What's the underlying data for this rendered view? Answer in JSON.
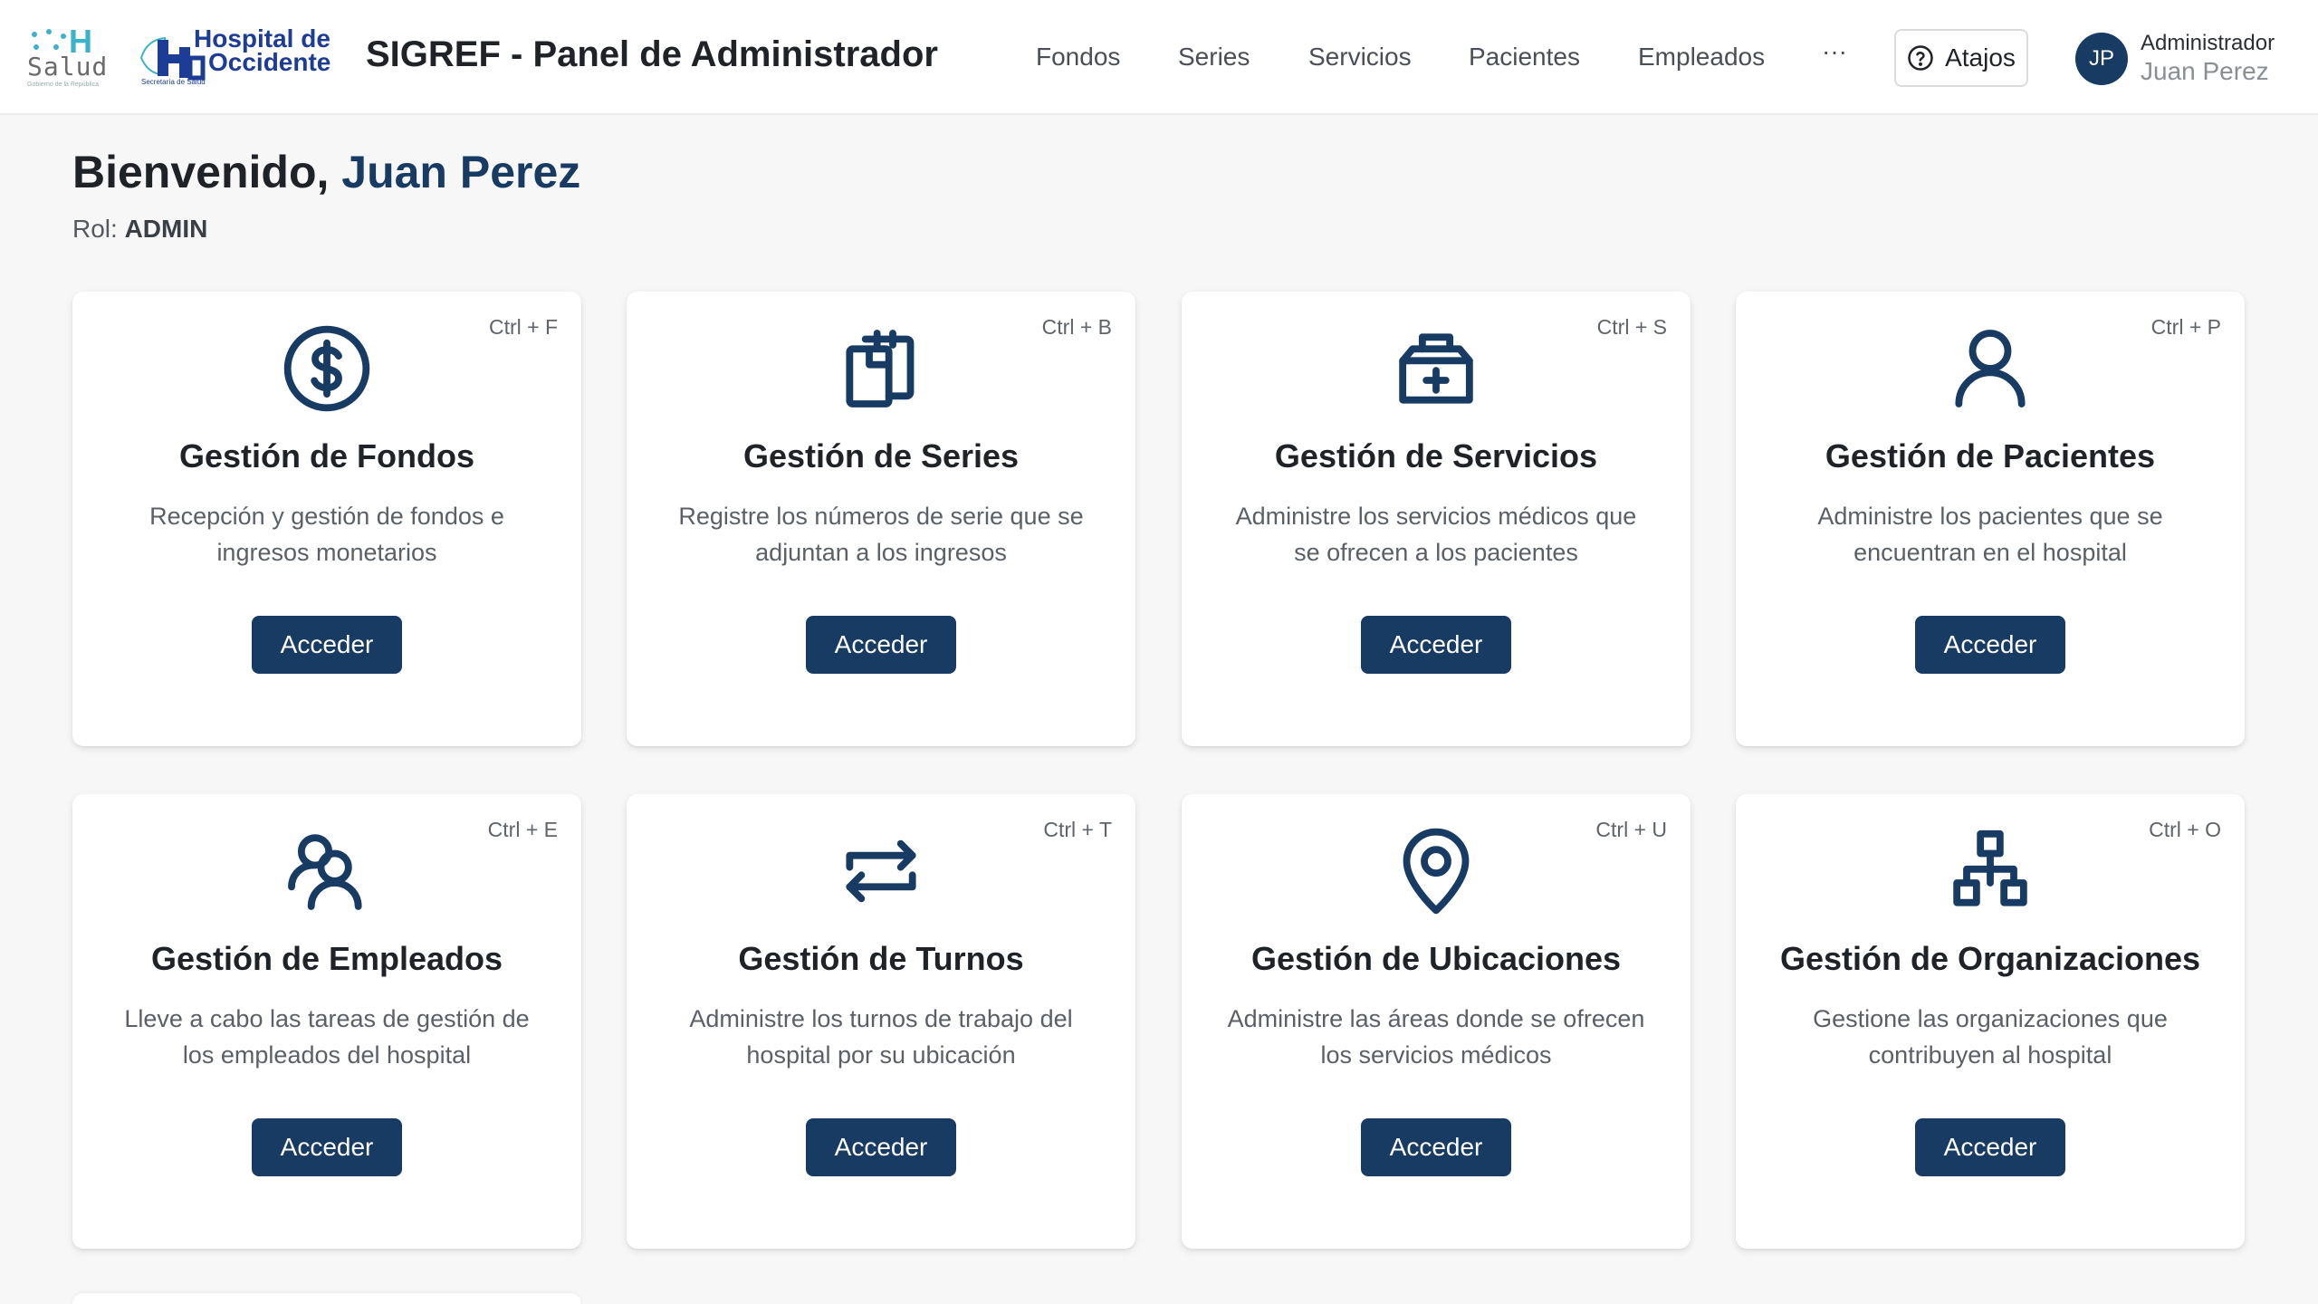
{
  "header": {
    "logo_salud": {
      "letter": "H",
      "word": "Salud",
      "tagline": "Gobierno de la República"
    },
    "logo_hospital": {
      "line1": "Hospital de",
      "line2": "Occidente",
      "line3": "Secretaría de Salud"
    },
    "app_title": "SIGREF - Panel de Administrador",
    "nav": [
      {
        "label": "Fondos"
      },
      {
        "label": "Series"
      },
      {
        "label": "Servicios"
      },
      {
        "label": "Pacientes"
      },
      {
        "label": "Empleados"
      }
    ],
    "more": "···",
    "shortcuts_button": "Atajos",
    "user": {
      "initials": "JP",
      "role": "Administrador",
      "name": "Juan Perez"
    }
  },
  "welcome": {
    "greeting": "Bienvenido, ",
    "name": "Juan Perez",
    "role_label": "Rol: ",
    "role_value": "ADMIN"
  },
  "cards": [
    {
      "shortcut": "Ctrl + F",
      "icon": "dollar-icon",
      "title": "Gestión de Fondos",
      "description": "Recepción y gestión de fondos e ingresos monetarios",
      "button": "Acceder"
    },
    {
      "shortcut": "Ctrl + B",
      "icon": "clipboard-docs-icon",
      "title": "Gestión de Series",
      "description": "Registre los números de serie que se adjuntan a los ingresos",
      "button": "Acceder"
    },
    {
      "shortcut": "Ctrl + S",
      "icon": "medical-kit-icon",
      "title": "Gestión de Servicios",
      "description": "Administre los servicios médicos que se ofrecen a los pacientes",
      "button": "Acceder"
    },
    {
      "shortcut": "Ctrl + P",
      "icon": "user-icon",
      "title": "Gestión de Pacientes",
      "description": "Administre los pacientes que se encuentran en el hospital",
      "button": "Acceder"
    },
    {
      "shortcut": "Ctrl + E",
      "icon": "users-icon",
      "title": "Gestión de Empleados",
      "description": "Lleve a cabo las tareas de gestión de los empleados del hospital",
      "button": "Acceder"
    },
    {
      "shortcut": "Ctrl + T",
      "icon": "repeat-icon",
      "title": "Gestión de Turnos",
      "description": "Administre los turnos de trabajo del hospital por su ubicación",
      "button": "Acceder"
    },
    {
      "shortcut": "Ctrl + U",
      "icon": "location-pin-icon",
      "title": "Gestión de Ubicaciones",
      "description": "Administre las áreas donde se ofrecen los servicios médicos",
      "button": "Acceder"
    },
    {
      "shortcut": "Ctrl + O",
      "icon": "org-chart-icon",
      "title": "Gestión de Organizaciones",
      "description": "Gestione las organizaciones que contribuyen al hospital",
      "button": "Acceder"
    }
  ],
  "colors": {
    "primary": "#173b63",
    "accent_logo": "#3db3c9",
    "hospital_blue": "#1c3c96"
  }
}
